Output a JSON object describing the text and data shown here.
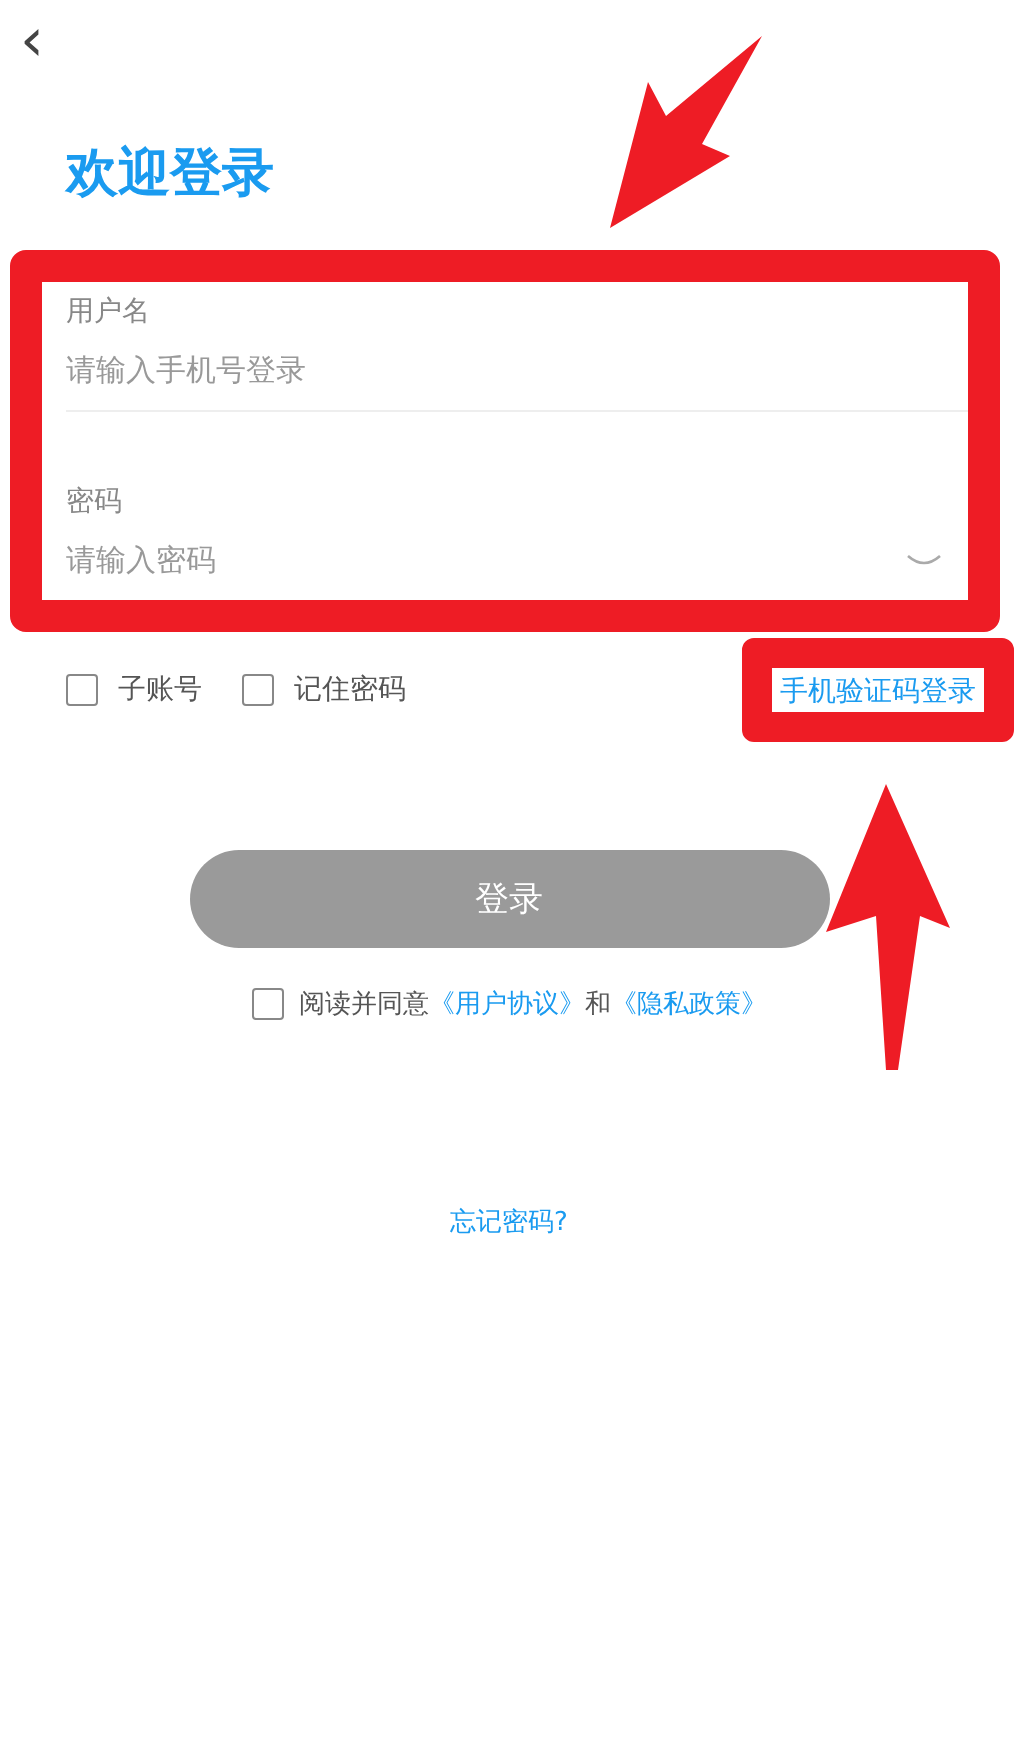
{
  "header": {
    "back": "‹",
    "title": "欢迎登录"
  },
  "form": {
    "fields": [
      {
        "kind": "text",
        "label": "用户名",
        "placeholder": "请输入手机号登录"
      },
      {
        "kind": "password",
        "label": "密码",
        "placeholder": "请输入密码"
      }
    ]
  },
  "options": [
    {
      "label": "子账号",
      "checked": false
    },
    {
      "label": "记住密码",
      "checked": false
    }
  ],
  "sms_login": "手机验证码登录",
  "login_button": "登录",
  "agreement": {
    "checked": false,
    "text": "阅读并同意",
    "link_1": "《用户协议》",
    "joiner": "和",
    "link_2": "《隐私政策》"
  },
  "forgot_password": "忘记密码?"
}
